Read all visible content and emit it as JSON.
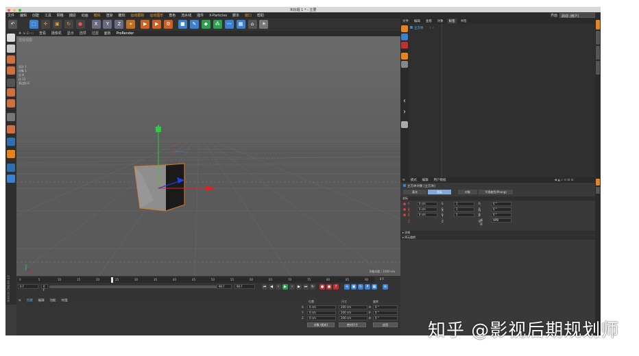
{
  "window": {
    "title": "未标题 1 * - 主要",
    "traffic_colors": [
      "#ff5f57",
      "#febc2e",
      "#28c840"
    ]
  },
  "menubar": {
    "items": [
      "文件",
      "编辑",
      "创建",
      "工具",
      "网格",
      "捕捉",
      "动画",
      "模拟",
      "渲染",
      "雕刻",
      "运动跟踪",
      "运动图形",
      "角色",
      "流水线",
      "插件",
      "X-Particles",
      "脚本",
      "窗口",
      "帮助"
    ],
    "layout_label": "界面",
    "layout_value": "启动 (用户)"
  },
  "toolbar": {
    "axis_x": "X",
    "axis_y": "Y",
    "axis_z": "Z"
  },
  "viewport": {
    "menu": [
      "查看",
      "摄像机",
      "显示",
      "选项",
      "过滤",
      "面板",
      "ProRender"
    ],
    "label": "透视视图",
    "stats": [
      "总计",
      "对象",
      "点",
      "边",
      "多边形",
      "选择"
    ],
    "stats_values": [
      "1",
      "1",
      "8",
      "12",
      "6",
      ""
    ],
    "grid_distance": "网格间距 : 1000 cm"
  },
  "timeline": {
    "ticks": [
      "0",
      "5",
      "10",
      "15",
      "20",
      "25",
      "30",
      "35",
      "40",
      "45",
      "50",
      "55",
      "60",
      "65",
      "70",
      "75",
      "80",
      "85",
      "90"
    ],
    "current_frame": "0 F",
    "start_field": "0 F",
    "min_field": "0 F",
    "end_field": "90 F",
    "max_field": "90 F"
  },
  "materials": {
    "menu": [
      "创建",
      "编辑",
      "功能",
      "纹理"
    ]
  },
  "coordinates": {
    "headers": [
      "位置",
      "尺寸",
      "旋转"
    ],
    "rows": [
      {
        "axis": "X",
        "pos": "0 cm",
        "size": "200 cm",
        "rot": "0 °",
        "rot_label": "H"
      },
      {
        "axis": "Y",
        "pos": "0 cm",
        "size": "200 cm",
        "rot": "0 °",
        "rot_label": "P"
      },
      {
        "axis": "Z",
        "pos": "0 cm",
        "size": "200 cm",
        "rot": "0 °",
        "rot_label": "B"
      }
    ],
    "mode_left": "对象 (相对)",
    "mode_mid": "绝对尺寸",
    "apply": "应用"
  },
  "object_manager": {
    "tabs": [
      "文件",
      "编辑",
      "查看",
      "对象",
      "标签",
      "书签"
    ],
    "active_tab": "对象",
    "object_name": "立方体"
  },
  "attributes": {
    "menu": [
      "模式",
      "编辑",
      "用户数据"
    ],
    "title": "立方体对象 [立方体]",
    "tabs": [
      "基本",
      "坐标",
      "对象",
      "平滑着色(Phong)"
    ],
    "active_tab": "坐标",
    "section": "坐标",
    "rows": [
      {
        "p": "P . X",
        "pv": "0 cm",
        "s": "S . X",
        "sv": "1",
        "r": "R . H",
        "rv": "0 °"
      },
      {
        "p": "P . Y",
        "pv": "0 cm",
        "s": "S . Y",
        "sv": "1",
        "r": "R . P",
        "rv": "0 °"
      },
      {
        "p": "P . Z",
        "pv": "0 cm",
        "s": "S . Z",
        "sv": "1",
        "r": "R . B",
        "rv": "0 °"
      }
    ],
    "order_label": "顺序",
    "order_value": "HPB",
    "collapsed_1": "▸ 冻结",
    "collapsed_2": "▸ 四元旋转"
  },
  "left_brand": "MAXON CINEMA 4D",
  "watermark": "知乎 @影视后期规划师",
  "colors": {
    "accent_orange": "#e8841a",
    "accent_blue": "#3a82d0",
    "axis_green": "#2ecc40",
    "axis_red": "#e62020",
    "axis_blue": "#2040e0"
  }
}
